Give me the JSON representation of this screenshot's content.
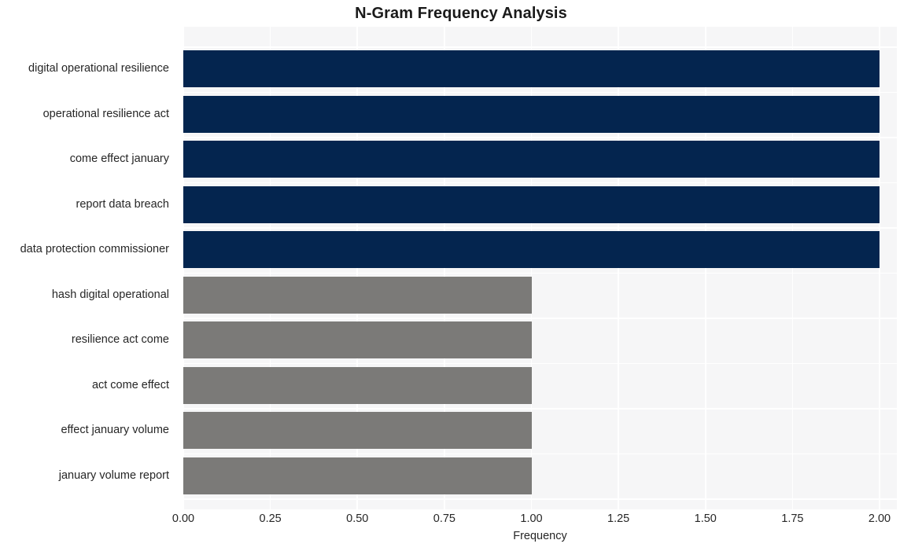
{
  "chart_data": {
    "type": "bar",
    "orientation": "horizontal",
    "title": "N-Gram Frequency Analysis",
    "xlabel": "Frequency",
    "ylabel": "",
    "xlim": [
      0.0,
      2.0
    ],
    "xticks": [
      "0.00",
      "0.25",
      "0.50",
      "0.75",
      "1.00",
      "1.25",
      "1.50",
      "1.75",
      "2.00"
    ],
    "xtick_values": [
      0.0,
      0.25,
      0.5,
      0.75,
      1.0,
      1.25,
      1.5,
      1.75,
      2.0
    ],
    "grid": true,
    "legend": "none",
    "categories": [
      "digital operational resilience",
      "operational resilience act",
      "come effect january",
      "report data breach",
      "data protection commissioner",
      "hash digital operational",
      "resilience act come",
      "act come effect",
      "effect january volume",
      "january volume report"
    ],
    "values": [
      2,
      2,
      2,
      2,
      2,
      1,
      1,
      1,
      1,
      1
    ],
    "bar_colors": [
      "#04254f",
      "#04254f",
      "#04254f",
      "#04254f",
      "#04254f",
      "#7b7a78",
      "#7b7a78",
      "#7b7a78",
      "#7b7a78",
      "#7b7a78"
    ]
  },
  "style": {
    "figure_background": "#ffffff",
    "plot_background": "#f6f6f7",
    "gridline_color": "#ffffff",
    "text_color": "#262626",
    "title_color": "#1a1a1a",
    "accent_primary": "#04254f",
    "accent_secondary": "#7b7a78"
  }
}
